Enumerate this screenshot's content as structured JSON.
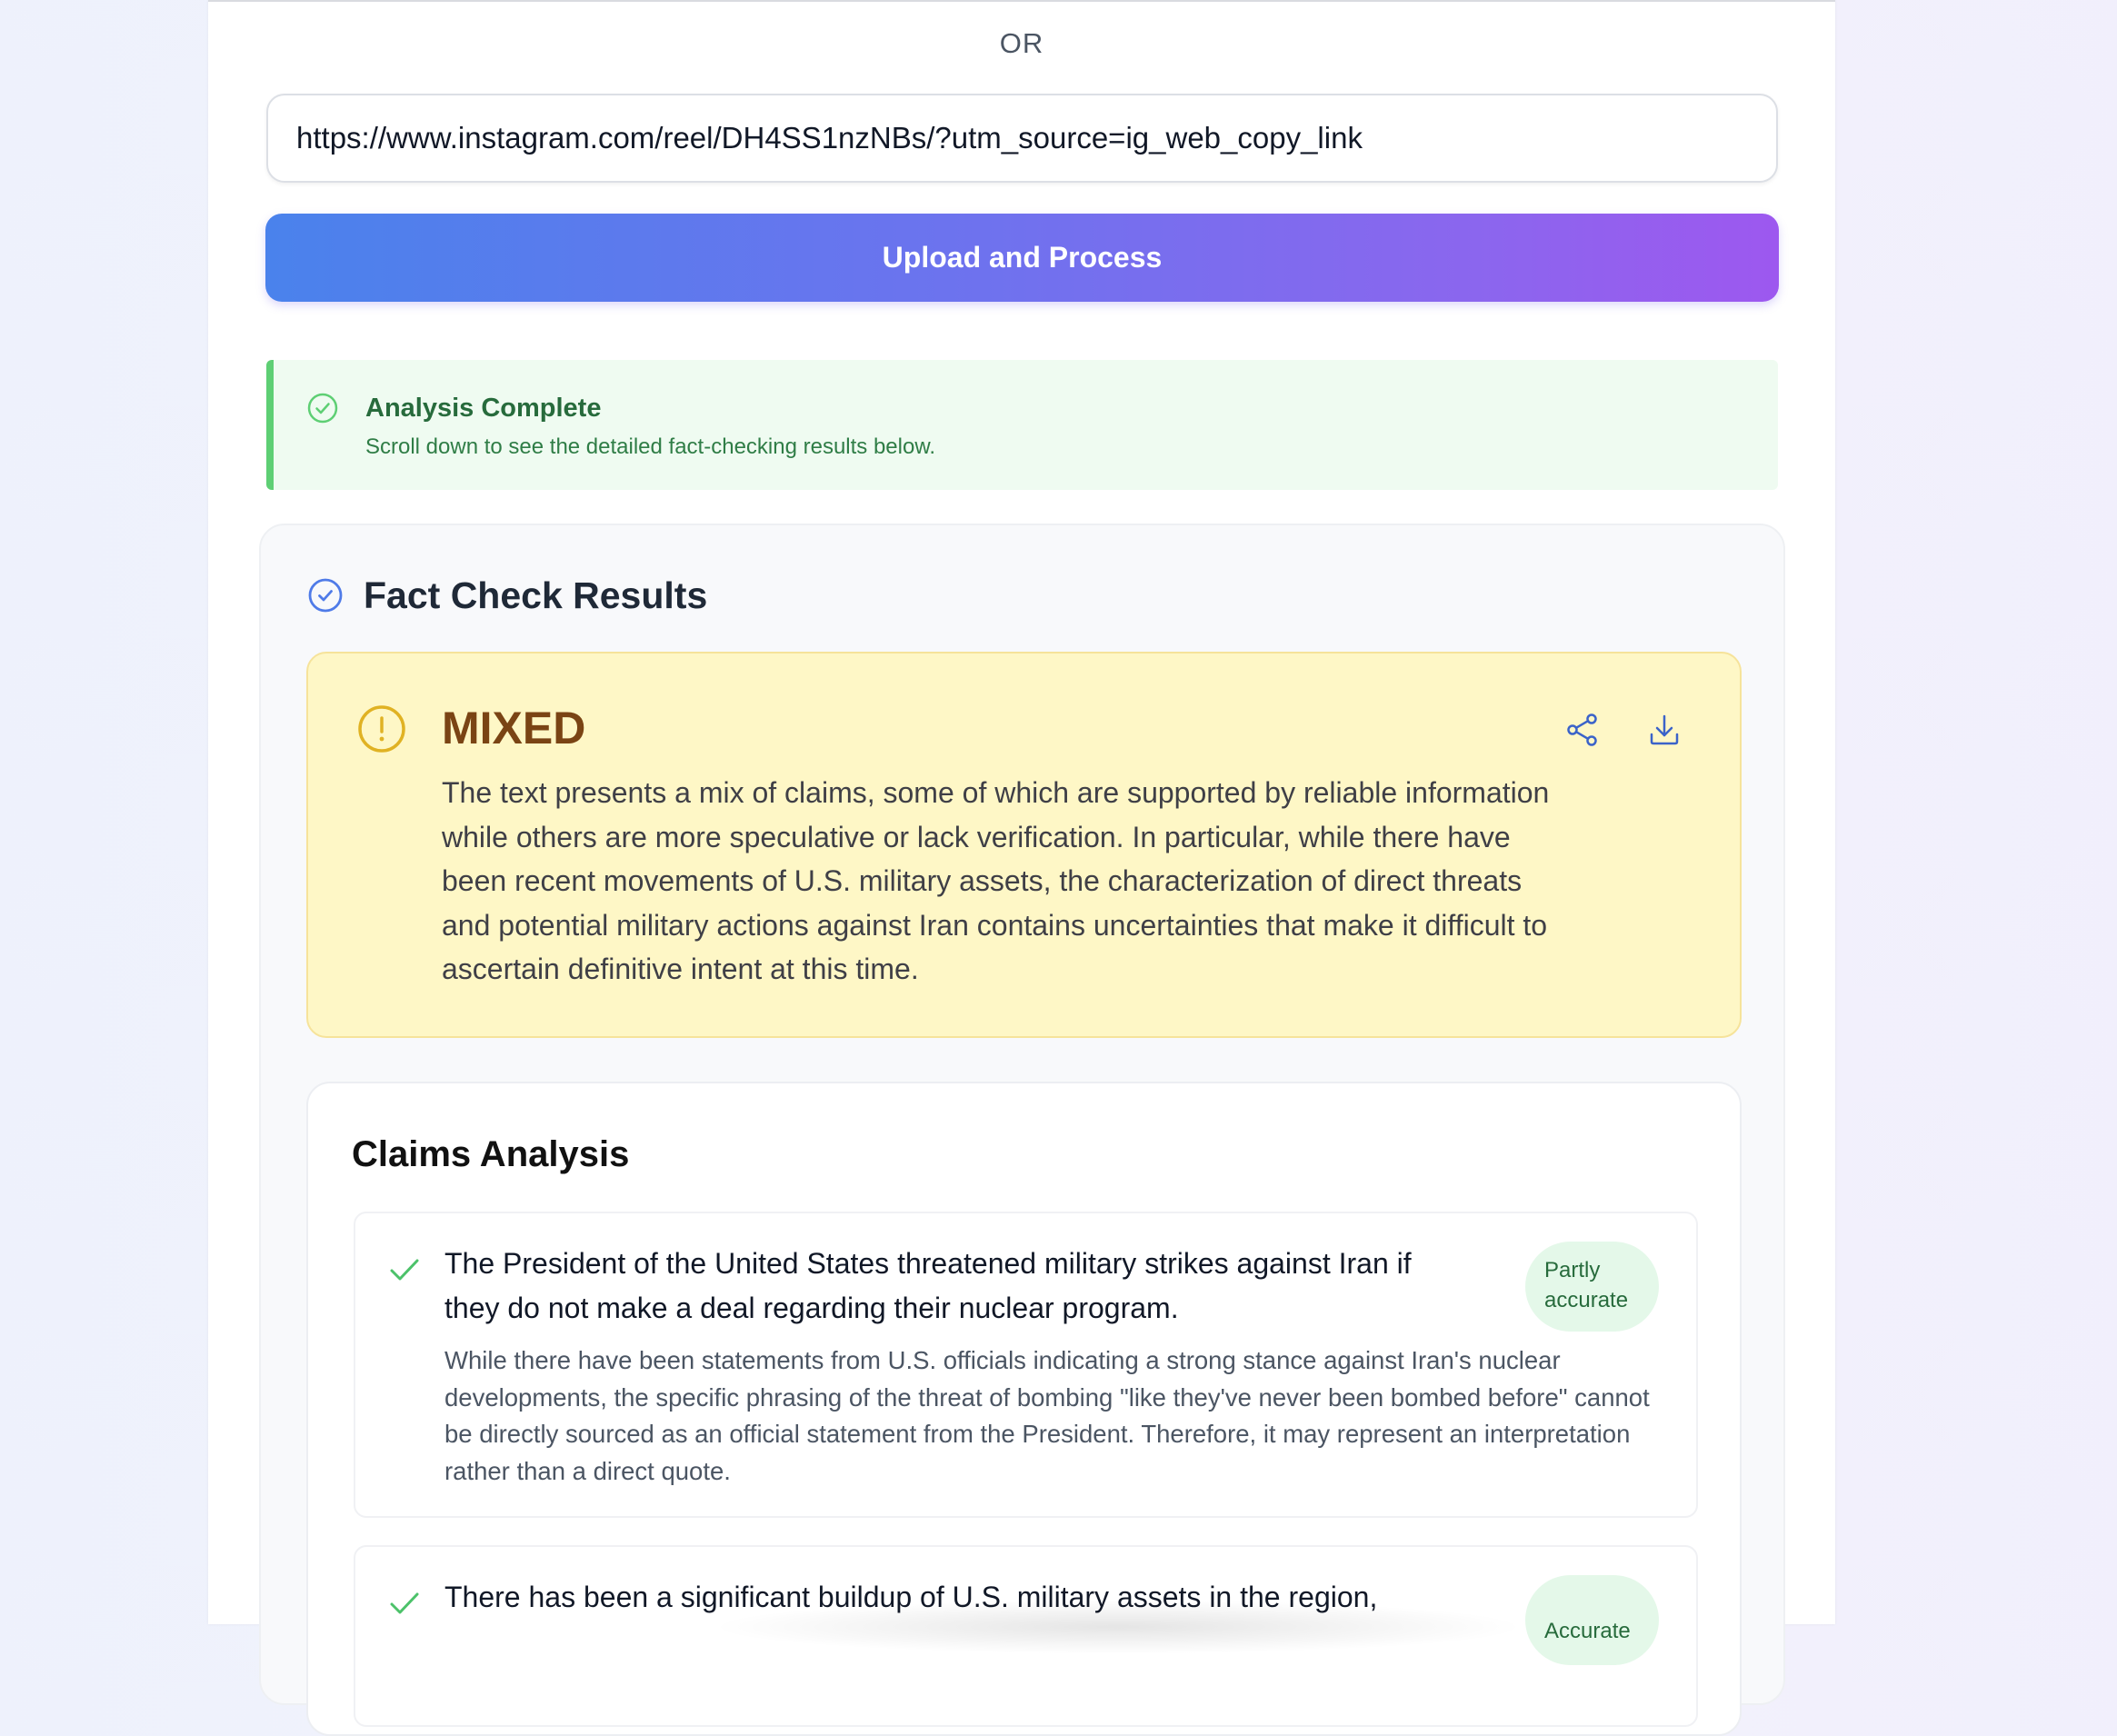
{
  "source": {
    "or_label": "OR",
    "url_value": "https://www.instagram.com/reel/DH4SS1nzNBs/?utm_source=ig_web_copy_link"
  },
  "upload_button": {
    "label": "Upload and Process",
    "gradient_start": "#4a82ec",
    "gradient_end": "#9d58ef"
  },
  "status_banner": {
    "icon": "check-circle-icon",
    "title": "Analysis Complete",
    "message": "Scroll down to see the detailed fact-checking results below.",
    "accent_color": "#5ecf74"
  },
  "results": {
    "icon": "check-circle-icon",
    "title": "Fact Check Results",
    "verdict": {
      "icon": "exclamation-circle-icon",
      "label": "MIXED",
      "summary": "The text presents a mix of claims, some of which are supported by reliable information while others are more speculative or lack verification. In particular, while there have been recent movements of U.S. military assets, the characterization of direct threats and potential military actions against Iran contains uncertainties that make it difficult to ascertain definitive intent at this time.",
      "background_color": "#fef7c6",
      "label_color": "#7a4414",
      "actions": [
        {
          "icon": "share-icon"
        },
        {
          "icon": "download-icon"
        }
      ]
    },
    "claims_analysis": {
      "title": "Claims Analysis",
      "claims": [
        {
          "icon": "checkmark-icon",
          "claim": "The President of the United States threatened military strikes against Iran if they do not make a deal regarding their nuclear program.",
          "rating": "Partly accurate",
          "explanation": "While there have been statements from U.S. officials indicating a strong stance against Iran's nuclear developments, the specific phrasing of the threat of bombing \"like they've never been bombed before\" cannot be directly sourced as an official statement from the President. Therefore, it may represent an interpretation rather than a direct quote."
        },
        {
          "icon": "checkmark-icon",
          "claim": "There has been a significant buildup of U.S. military assets in the region,",
          "rating": "Accurate",
          "explanation": ""
        }
      ]
    }
  }
}
